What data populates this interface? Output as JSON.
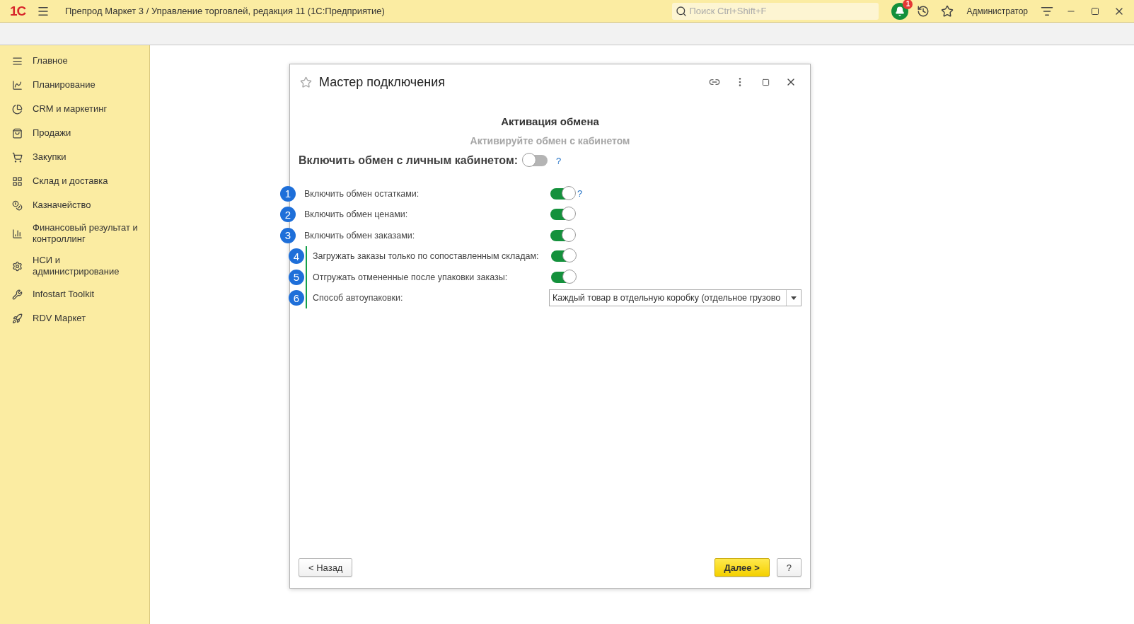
{
  "app_bar": {
    "logo": "1С",
    "title": "Препрод Маркет 3 / Управление торговлей, редакция 11  (1С:Предприятие)",
    "search": {
      "placeholder": "Поиск Ctrl+Shift+F"
    },
    "notifications_count": "1",
    "user": "Администратор"
  },
  "sidebar": {
    "items": [
      {
        "label": "Главное"
      },
      {
        "label": "Планирование"
      },
      {
        "label": "CRM и маркетинг"
      },
      {
        "label": "Продажи"
      },
      {
        "label": "Закупки"
      },
      {
        "label": "Склад и доставка"
      },
      {
        "label": "Казначейство"
      },
      {
        "label": "Финансовый результат и контроллинг"
      },
      {
        "label": "НСИ и администрирование"
      },
      {
        "label": "Infostart Toolkit"
      },
      {
        "label": "RDV Маркет"
      }
    ]
  },
  "dialog": {
    "title": "Мастер подключения",
    "heading": "Активация обмена",
    "subheading": "Активируйте обмен с кабинетом",
    "main_switch": {
      "label": "Включить обмен с личным кабинетом:",
      "on": false,
      "help": "?"
    },
    "options": [
      {
        "number": "1",
        "label": "Включить обмен остатками:",
        "kind": "switch",
        "on": true,
        "help": "?"
      },
      {
        "number": "2",
        "label": "Включить обмен ценами:",
        "kind": "switch",
        "on": true
      },
      {
        "number": "3",
        "label": "Включить обмен заказами:",
        "kind": "switch",
        "on": true,
        "children": [
          {
            "number": "4",
            "label": "Загружать заказы только по сопоставленным складам:",
            "kind": "switch",
            "on": true
          },
          {
            "number": "5",
            "label": "Отгружать отмененные после упаковки заказы:",
            "kind": "switch",
            "on": true
          },
          {
            "number": "6",
            "label": "Способ автоупаковки:",
            "kind": "select",
            "value": "Каждый товар в отдельную коробку (отдельное грузово"
          }
        ]
      }
    ],
    "buttons": [
      {
        "label": "< Назад",
        "kind": "default"
      },
      {
        "label": "Далее >",
        "kind": "primary"
      },
      {
        "label": "?",
        "kind": "default"
      }
    ]
  }
}
